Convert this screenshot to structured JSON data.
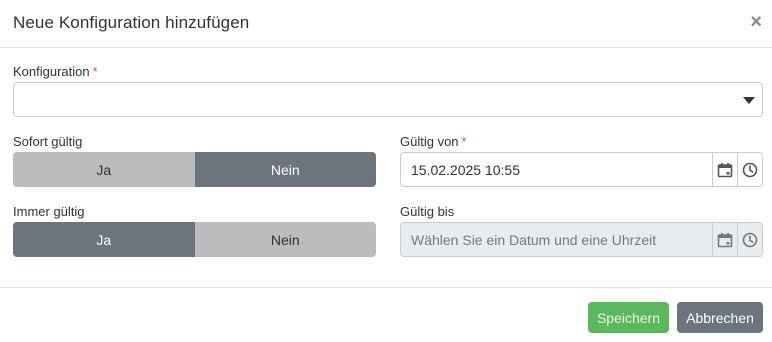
{
  "dialog": {
    "title": "Neue Konfiguration hinzufügen",
    "close_symbol": "×"
  },
  "konfiguration": {
    "label": "Konfiguration",
    "required_mark": "*",
    "value": ""
  },
  "sofort_gueltig": {
    "label": "Sofort gültig",
    "yes_label": "Ja",
    "no_label": "Nein",
    "selected": "Nein"
  },
  "immer_gueltig": {
    "label": "Immer gültig",
    "yes_label": "Ja",
    "no_label": "Nein",
    "selected": "Ja"
  },
  "gueltig_von": {
    "label": "Gültig von",
    "required_mark": "*",
    "value": "15.02.2025 10:55"
  },
  "gueltig_bis": {
    "label": "Gültig bis",
    "placeholder": "Wählen Sie ein Datum und eine Uhrzeit"
  },
  "footer": {
    "save_label": "Speichern",
    "cancel_label": "Abbrechen"
  },
  "colors": {
    "toggle_active": "#6c757d",
    "toggle_inactive": "#bcbcbc",
    "save_button": "#5cb85c",
    "cancel_button": "#6c757d",
    "required": "#d9534f"
  },
  "icons": [
    "close-icon",
    "chevron-down-icon",
    "calendar-icon",
    "clock-icon"
  ]
}
